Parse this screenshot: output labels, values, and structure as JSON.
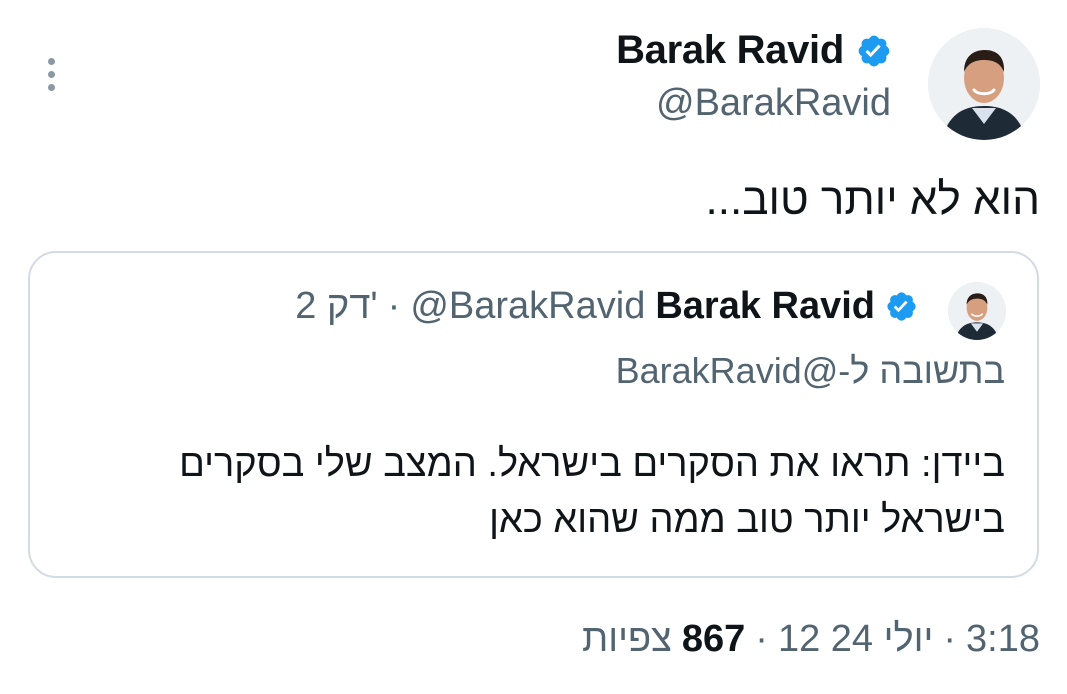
{
  "author": {
    "name": "Barak Ravid",
    "handle": "@BarakRavid",
    "verified_color": "#1d9bf0",
    "avatar_icon": "profile-photo"
  },
  "tweet": {
    "text": "הוא לא יותר טוב..."
  },
  "quoted_tweet": {
    "name": "Barak Ravid",
    "handle": "@BarakRavid",
    "separator": "·",
    "time_ago": "2 דק'",
    "reply_to": "בתשובה ל-@BarakRavid",
    "body": "ביידן: תראו את הסקרים בישראל. המצב שלי בסקרים בישראל יותר טוב ממה שהוא כאן"
  },
  "meta": {
    "time": "3:18",
    "date": "12 יולי 24",
    "separator": "·",
    "views_count": "867",
    "views_label": "צפיות"
  },
  "icons": {
    "more": "more-vertical-icon",
    "verified": "verified-badge-icon"
  }
}
